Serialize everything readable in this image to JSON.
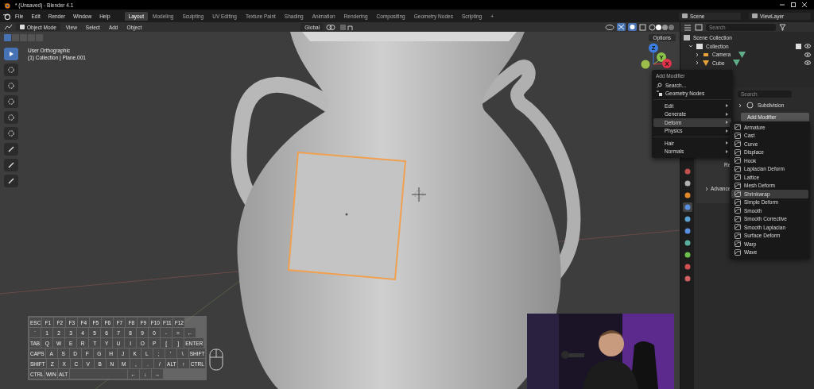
{
  "window": {
    "title": "* (Unsaved) - Blender 4.1"
  },
  "menu_bar": [
    "File",
    "Edit",
    "Render",
    "Window",
    "Help"
  ],
  "workspace_tabs": [
    {
      "label": "Layout",
      "selected": true
    },
    {
      "label": "Modeling",
      "selected": false
    },
    {
      "label": "Sculpting",
      "selected": false
    },
    {
      "label": "UV Editing",
      "selected": false
    },
    {
      "label": "Texture Paint",
      "selected": false
    },
    {
      "label": "Shading",
      "selected": false
    },
    {
      "label": "Animation",
      "selected": false
    },
    {
      "label": "Rendering",
      "selected": false
    },
    {
      "label": "Compositing",
      "selected": false
    },
    {
      "label": "Geometry Nodes",
      "selected": false
    },
    {
      "label": "Scripting",
      "selected": false
    }
  ],
  "add_workspace": "+",
  "scene": "Scene",
  "view_layer": "ViewLayer",
  "viewport_header": {
    "mode": "Object Mode",
    "menus": [
      "View",
      "Select",
      "Add",
      "Object"
    ],
    "orientation": "Global",
    "options": "Options"
  },
  "select_modes": [
    {
      "selected": true
    },
    {
      "selected": false
    },
    {
      "selected": false
    },
    {
      "selected": false
    },
    {
      "selected": false
    }
  ],
  "tools": [
    {
      "selected": true
    },
    {
      "selected": false
    },
    {
      "selected": false
    },
    {
      "selected": false
    },
    {
      "selected": false
    },
    {
      "selected": false
    },
    {
      "selected": false
    },
    {
      "selected": false
    },
    {
      "selected": false
    }
  ],
  "viewport": {
    "view_name": "User Orthographic",
    "context": "(1) Collection | Plane.001"
  },
  "gizmo": [
    {
      "label": "Z",
      "color": "#3b7de0"
    },
    {
      "label": "Y",
      "color": "#8bc34a"
    },
    {
      "label": "X",
      "color": "#e0344a"
    }
  ],
  "outliner": {
    "search": {
      "placeholder": "Search"
    },
    "items": [
      {
        "label": "Scene Collection",
        "children": [
          {
            "label": "Collection",
            "expanded": true,
            "children": [
              {
                "label": "Camera",
                "expanded": false
              },
              {
                "label": "Cube",
                "expanded": false
              }
            ]
          }
        ]
      }
    ]
  },
  "property_tabs": [
    {
      "color": "#c0504d",
      "selected": false
    },
    {
      "color": "#b0b0b0",
      "selected": false
    },
    {
      "color": "#e08a2c",
      "selected": false
    },
    {
      "color": "#5a8fe0",
      "selected": true
    },
    {
      "color": "#5aa0d0",
      "selected": false
    },
    {
      "color": "#5a8fe0",
      "selected": false
    },
    {
      "color": "#5ab0a0",
      "selected": false
    },
    {
      "color": "#6ac04a",
      "selected": false
    },
    {
      "color": "#d05050",
      "selected": false
    },
    {
      "color": "#d06060",
      "selected": false
    }
  ],
  "properties": {
    "search": {
      "placeholder": "Search"
    },
    "modifier": "Subdivision",
    "add_modifier": "Add Modifier",
    "panel_label": "Re",
    "subpanel": "Advance"
  },
  "add_modifier_menu": {
    "title": "Add Modifier",
    "search": "Search...",
    "items": [
      {
        "label": "Geometry Nodes",
        "kind": "entry",
        "selected": false
      },
      {
        "label": "Edit",
        "kind": "submenu",
        "selected": false
      },
      {
        "label": "Generate",
        "kind": "submenu",
        "selected": false
      },
      {
        "label": "Deform",
        "kind": "submenu",
        "selected": true
      },
      {
        "label": "Physics",
        "kind": "submenu",
        "selected": false
      },
      {
        "label": "Hair",
        "kind": "submenu",
        "selected": false
      },
      {
        "label": "Normals",
        "kind": "submenu",
        "selected": false
      }
    ]
  },
  "deform_submenu": [
    {
      "label": "Armature",
      "selected": false
    },
    {
      "label": "Cast",
      "selected": false
    },
    {
      "label": "Curve",
      "selected": false
    },
    {
      "label": "Displace",
      "selected": false
    },
    {
      "label": "Hook",
      "selected": false
    },
    {
      "label": "Laplacian Deform",
      "selected": false
    },
    {
      "label": "Lattice",
      "selected": false
    },
    {
      "label": "Mesh Deform",
      "selected": false
    },
    {
      "label": "Shrinkwrap",
      "selected": true
    },
    {
      "label": "Simple Deform",
      "selected": false
    },
    {
      "label": "Smooth",
      "selected": false
    },
    {
      "label": "Smooth Corrective",
      "selected": false
    },
    {
      "label": "Smooth Laplacian",
      "selected": false
    },
    {
      "label": "Surface Deform",
      "selected": false
    },
    {
      "label": "Warp",
      "selected": false
    },
    {
      "label": "Wave",
      "selected": false
    }
  ],
  "keyboard": [
    [
      "ESC",
      "F1",
      "F2",
      "F3",
      "F4",
      "F5",
      "F6",
      "F7",
      "F8",
      "F9",
      "F10",
      "F11",
      "F12"
    ],
    [
      "`",
      "1",
      "2",
      "3",
      "4",
      "5",
      "6",
      "7",
      "8",
      "9",
      "0",
      "-",
      "=",
      "←"
    ],
    [
      "TAB",
      "Q",
      "W",
      "E",
      "R",
      "T",
      "Y",
      "U",
      "I",
      "O",
      "P",
      "[",
      "]",
      "ENTER"
    ],
    [
      "CAPS",
      "A",
      "S",
      "D",
      "F",
      "G",
      "H",
      "J",
      "K",
      "L",
      ";",
      "'",
      "\\",
      "SHIFT"
    ],
    [
      "SHIFT",
      "Z",
      "X",
      "C",
      "V",
      "B",
      "N",
      "M",
      ",",
      ".",
      "/",
      "ALT",
      "↑",
      "CTRL"
    ],
    [
      "CTRL",
      "WIN",
      "ALT",
      "←",
      "↓",
      "→"
    ]
  ],
  "webcam": {
    "kind": "picture"
  }
}
